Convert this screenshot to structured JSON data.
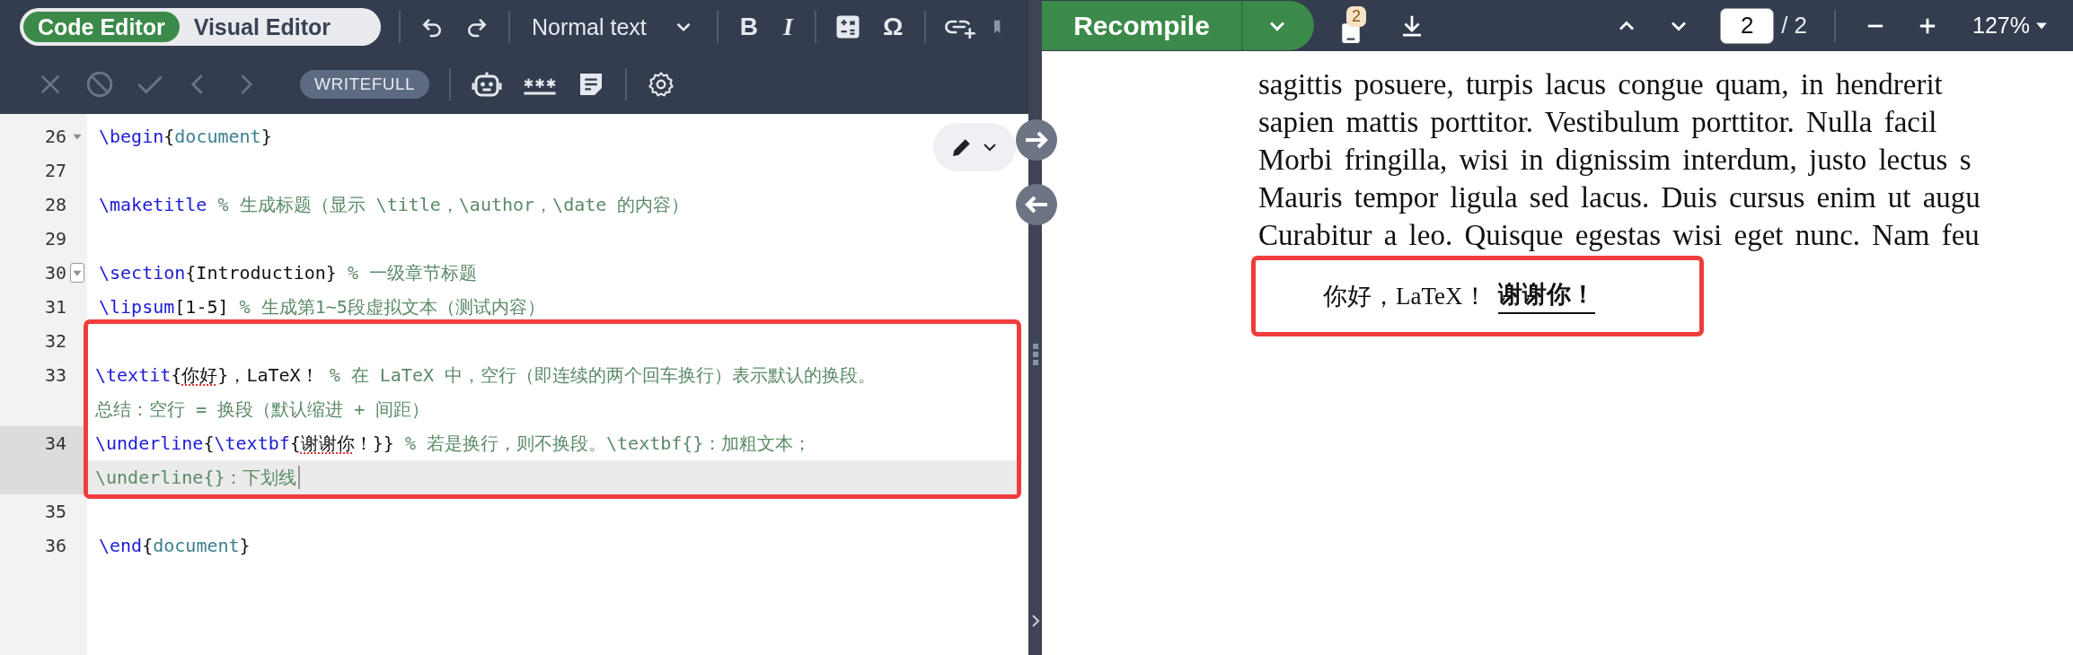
{
  "editor_toolbar": {
    "mode_switch": [
      {
        "label": "Code Editor",
        "selected": true
      },
      {
        "label": "Visual Editor",
        "selected": false
      }
    ],
    "style_dropdown": "Normal text",
    "bold": "B",
    "italic": "I",
    "symbol": "Ω",
    "writefull": "WRITEFULL"
  },
  "editor": {
    "line_groups": [
      {
        "boxed": false,
        "lines": [
          {
            "number": "26",
            "fold": true,
            "fold_hovered": false,
            "active": false,
            "rows": [
              {
                "highlighted": false,
                "tokens": [
                  {
                    "kind": "command",
                    "text": "\\begin"
                  },
                  {
                    "kind": "plain",
                    "text": "{"
                  },
                  {
                    "kind": "argument",
                    "text": "document"
                  },
                  {
                    "kind": "plain",
                    "text": "}"
                  }
                ]
              }
            ]
          },
          {
            "number": "27",
            "fold": false,
            "active": false,
            "rows": [
              {
                "highlighted": false,
                "tokens": []
              }
            ]
          },
          {
            "number": "28",
            "fold": false,
            "active": false,
            "rows": [
              {
                "highlighted": false,
                "tokens": [
                  {
                    "kind": "command",
                    "text": "\\maketitle"
                  },
                  {
                    "kind": "comment",
                    "text": " % 生成标题（显示 \\title，\\author，\\date 的内容）"
                  }
                ]
              }
            ]
          },
          {
            "number": "29",
            "fold": false,
            "active": false,
            "rows": [
              {
                "highlighted": false,
                "tokens": []
              }
            ]
          },
          {
            "number": "30",
            "fold": true,
            "fold_hovered": true,
            "active": false,
            "rows": [
              {
                "highlighted": false,
                "tokens": [
                  {
                    "kind": "command",
                    "text": "\\section"
                  },
                  {
                    "kind": "plain",
                    "text": "{Introduction}"
                  },
                  {
                    "kind": "comment",
                    "text": " % 一级章节标题"
                  }
                ]
              }
            ]
          },
          {
            "number": "31",
            "fold": false,
            "active": false,
            "rows": [
              {
                "highlighted": false,
                "tokens": [
                  {
                    "kind": "command",
                    "text": "\\lipsum"
                  },
                  {
                    "kind": "plain",
                    "text": "[1-5]"
                  },
                  {
                    "kind": "comment",
                    "text": " % 生成第1~5段虚拟文本（测试内容）"
                  }
                ]
              }
            ]
          }
        ]
      },
      {
        "boxed": true,
        "lines": [
          {
            "number": "32",
            "fold": false,
            "active": false,
            "rows": [
              {
                "highlighted": false,
                "tokens": []
              }
            ]
          },
          {
            "number": "33",
            "fold": false,
            "active": false,
            "rows": [
              {
                "highlighted": false,
                "tokens": [
                  {
                    "kind": "command",
                    "text": "\\textit"
                  },
                  {
                    "kind": "plain",
                    "text": "{"
                  },
                  {
                    "kind": "misspelled",
                    "text": "你好"
                  },
                  {
                    "kind": "plain",
                    "text": "}，LaTeX！"
                  },
                  {
                    "kind": "comment",
                    "text": " % 在 LaTeX 中，空行（即连续的两个回车换行）表示默认的换段。"
                  }
                ]
              },
              {
                "highlighted": false,
                "tokens": [
                  {
                    "kind": "comment",
                    "text": "总结：空行 = 换段（默认缩进 + 间距）"
                  }
                ]
              }
            ]
          },
          {
            "number": "34",
            "fold": false,
            "active": true,
            "rows": [
              {
                "highlighted": false,
                "tokens": [
                  {
                    "kind": "command",
                    "text": "\\underline"
                  },
                  {
                    "kind": "plain",
                    "text": "{"
                  },
                  {
                    "kind": "command",
                    "text": "\\textbf"
                  },
                  {
                    "kind": "plain",
                    "text": "{"
                  },
                  {
                    "kind": "misspelled",
                    "text": "谢谢你"
                  },
                  {
                    "kind": "plain",
                    "text": "！}}"
                  },
                  {
                    "kind": "comment",
                    "text": " % 若是换行，则不换段。\\textbf{}：加粗文本；"
                  }
                ]
              },
              {
                "highlighted": true,
                "tokens": [
                  {
                    "kind": "comment",
                    "text": "\\underline{}：下划线"
                  }
                ]
              }
            ]
          }
        ]
      },
      {
        "boxed": false,
        "lines": [
          {
            "number": "35",
            "fold": false,
            "active": false,
            "rows": [
              {
                "highlighted": false,
                "tokens": []
              }
            ]
          },
          {
            "number": "36",
            "fold": false,
            "active": false,
            "rows": [
              {
                "highlighted": false,
                "tokens": [
                  {
                    "kind": "command",
                    "text": "\\end"
                  },
                  {
                    "kind": "plain",
                    "text": "{"
                  },
                  {
                    "kind": "argument",
                    "text": "document"
                  },
                  {
                    "kind": "plain",
                    "text": "}"
                  }
                ]
              }
            ]
          }
        ]
      }
    ]
  },
  "pdf_toolbar": {
    "recompile": "Recompile",
    "log_badge": "2",
    "page": "2",
    "page_total": "/ 2",
    "zoom": "127%"
  },
  "preview": {
    "lines": [
      "sagittis posuere, turpis lacus congue quam, in hendrerit",
      "sapien mattis porttitor. Vestibulum porttitor. Nulla facil",
      "Morbi fringilla, wisi in dignissim interdum, justo lectus s",
      "Mauris tempor ligula sed lacus. Duis cursus enim ut augu",
      "Curabitur a leo. Quisque egestas wisi eget nunc. Nam feu"
    ],
    "boxed_line": {
      "plain": "你好，LaTeX！",
      "bold_underlined": "谢谢你！"
    }
  }
}
